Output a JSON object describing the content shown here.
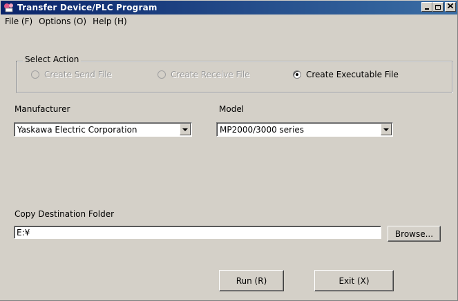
{
  "window": {
    "title": "Transfer Device/PLC Program",
    "minimize": "_",
    "maximize": "□",
    "close": "✕"
  },
  "menubar": {
    "items": [
      "File (F)",
      "Options (O)",
      "Help (H)"
    ]
  },
  "select_action": {
    "label": "Select Action",
    "options": [
      {
        "label": "Create Send File",
        "enabled": false,
        "selected": false
      },
      {
        "label": "Create Receive File",
        "enabled": false,
        "selected": false
      },
      {
        "label": "Create Executable File",
        "enabled": true,
        "selected": true
      }
    ]
  },
  "manufacturer": {
    "label": "Manufacturer",
    "value": "Yaskawa Electric Corporation"
  },
  "model": {
    "label": "Model",
    "value": "MP2000/3000 series"
  },
  "destination": {
    "label": "Copy Destination Folder",
    "value": "E:¥",
    "browse_label": "Browse..."
  },
  "actions": {
    "run_label": "Run (R)",
    "exit_label": "Exit (X)"
  },
  "icons": {
    "app": "transfer-app-icon",
    "dropdown": "chevron-down-icon"
  },
  "colors": {
    "titlebar_start": "#0a246a",
    "titlebar_end": "#3a6ea5",
    "face": "#d4d0c8",
    "disabled_text": "#9a9a9a"
  }
}
